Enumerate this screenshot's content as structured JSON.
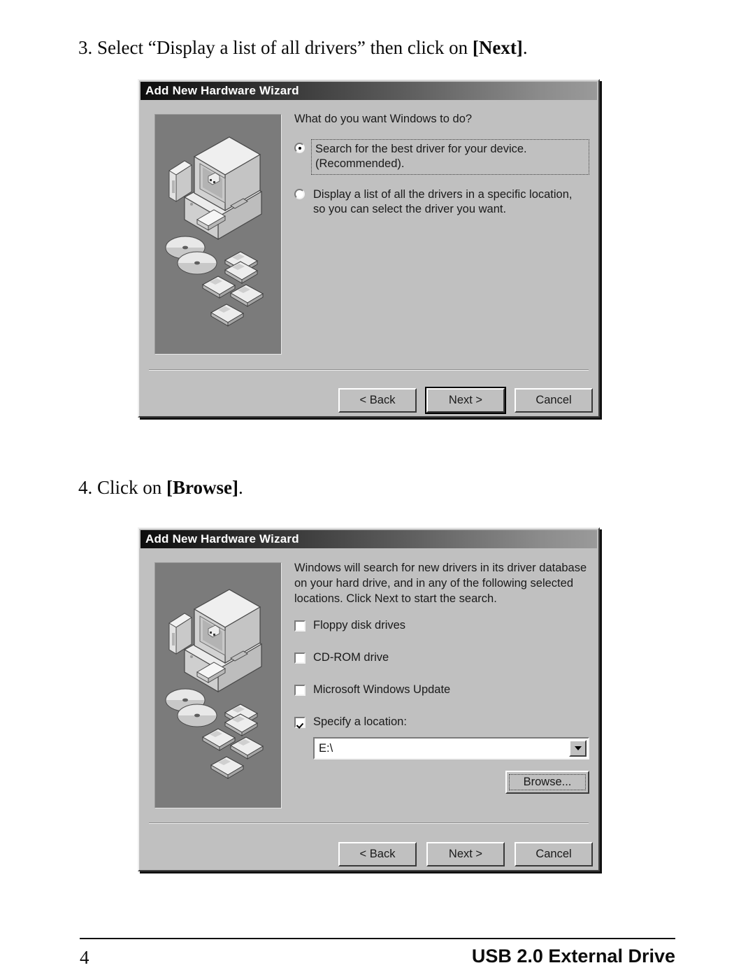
{
  "page": {
    "step3": {
      "prefix": "3. Select “Display a list of all drivers” then click on ",
      "emphasis": "[Next]",
      "suffix": "."
    },
    "step4": {
      "prefix": "4. Click on ",
      "emphasis": "[Browse]",
      "suffix": "."
    },
    "footer": {
      "page_number": "4",
      "product": "USB 2.0 External Drive"
    }
  },
  "dialog1": {
    "title": "Add New Hardware Wizard",
    "heading": "What do you want Windows to do?",
    "options": [
      {
        "label": "Search for the best driver for your device. (Recommended).",
        "selected": true,
        "focused": true
      },
      {
        "label": "Display a list of all the drivers in a specific location, so you can select the driver you want.",
        "selected": false,
        "focused": false
      }
    ],
    "buttons": [
      {
        "label": "< Back",
        "default": false
      },
      {
        "label": "Next >",
        "default": true
      },
      {
        "label": "Cancel",
        "default": false
      }
    ]
  },
  "dialog2": {
    "title": "Add New Hardware Wizard",
    "paragraph": "Windows will search for new drivers in its driver database on your hard drive, and in any of the following selected locations. Click Next to start the search.",
    "checkboxes": [
      {
        "label": "Floppy disk drives",
        "accel": "F",
        "checked": false
      },
      {
        "label": "CD-ROM drive",
        "accel": "C",
        "checked": false
      },
      {
        "label": "Microsoft Windows Update",
        "accel": "M",
        "checked": false
      },
      {
        "label": "Specify a location:",
        "accel": "l",
        "checked": true
      }
    ],
    "location_combo": {
      "value": "E:\\",
      "dropdown_icon": "chevron-down-icon"
    },
    "browse_button": {
      "label": "Browse...",
      "focused": true
    },
    "buttons": [
      {
        "label": "< Back",
        "default": false
      },
      {
        "label": "Next >",
        "default": false
      },
      {
        "label": "Cancel",
        "default": false
      }
    ]
  },
  "illustration": {
    "name": "computer-with-media-illustration",
    "background_color": "#7b7b7b",
    "items": [
      "monitor",
      "desktop-tower",
      "floppy-drive",
      "cd-disc",
      "cd-disc",
      "floppy-disk",
      "floppy-disk",
      "floppy-disk",
      "floppy-disk",
      "floppy-disk"
    ]
  },
  "theme": {
    "dialog_face": "#c0c0c0",
    "titlebar_dark": "#0d0d0d",
    "titlebar_light": "#9a9a9a",
    "text": "#1a1a1a",
    "field_bg": "#ffffff"
  }
}
